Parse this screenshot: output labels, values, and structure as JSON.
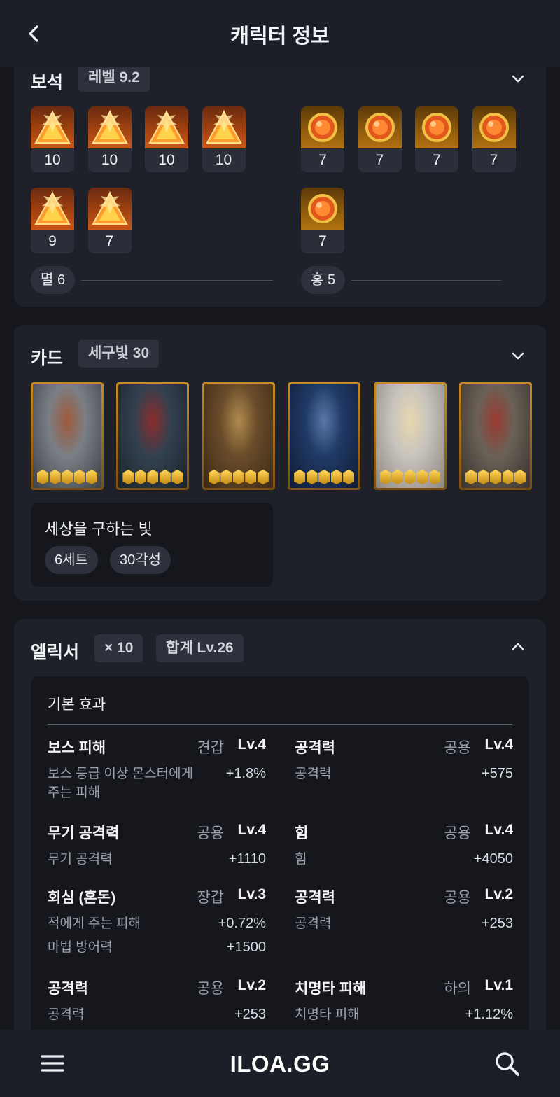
{
  "header": {
    "title": "캐릭터 정보",
    "back_icon": "chevron-left-icon"
  },
  "gems": {
    "title": "보석",
    "level_chip": "레벨 9.2",
    "left_items": [
      {
        "level": "10",
        "type": "red"
      },
      {
        "level": "10",
        "type": "red"
      },
      {
        "level": "10",
        "type": "red"
      },
      {
        "level": "10",
        "type": "red"
      },
      {
        "level": "9",
        "type": "red"
      },
      {
        "level": "7",
        "type": "red"
      }
    ],
    "right_items": [
      {
        "level": "7",
        "type": "orange"
      },
      {
        "level": "7",
        "type": "orange"
      },
      {
        "level": "7",
        "type": "orange"
      },
      {
        "level": "7",
        "type": "orange"
      },
      {
        "level": "7",
        "type": "orange"
      }
    ],
    "left_group": "멸 6",
    "right_group": "홍 5"
  },
  "cards": {
    "title": "카드",
    "set_chip": "세구빛 30",
    "count": 6,
    "awakening_per_card": 5,
    "set_name": "세상을 구하는 빛",
    "set_count": "6세트",
    "set_awakening": "30각성"
  },
  "elixir": {
    "title": "엘릭서",
    "count_chip": "× 10",
    "total_chip": "합계 Lv.26",
    "box_title": "기본 효과",
    "effects": [
      {
        "name": "보스 피해",
        "slot": "견갑",
        "level": "Lv.4",
        "lines": [
          {
            "label": "보스 등급 이상 몬스터에게 주는 피해",
            "value": "+1.8%"
          }
        ]
      },
      {
        "name": "공격력",
        "slot": "공용",
        "level": "Lv.4",
        "lines": [
          {
            "label": "공격력",
            "value": "+575"
          }
        ]
      },
      {
        "name": "무기 공격력",
        "slot": "공용",
        "level": "Lv.4",
        "lines": [
          {
            "label": "무기 공격력",
            "value": "+1110"
          }
        ]
      },
      {
        "name": "힘",
        "slot": "공용",
        "level": "Lv.4",
        "lines": [
          {
            "label": "힘",
            "value": "+4050"
          }
        ]
      },
      {
        "name": "회심 (혼돈)",
        "slot": "장갑",
        "level": "Lv.3",
        "lines": [
          {
            "label": "적에게 주는 피해",
            "value": "+0.72%"
          },
          {
            "label": "마법 방어력",
            "value": "+1500"
          }
        ]
      },
      {
        "name": "공격력",
        "slot": "공용",
        "level": "Lv.2",
        "lines": [
          {
            "label": "공격력",
            "value": "+253"
          }
        ]
      },
      {
        "name": "공격력",
        "slot": "공용",
        "level": "Lv.2",
        "lines": [
          {
            "label": "공격력",
            "value": "+253"
          }
        ]
      },
      {
        "name": "치명타 피해",
        "slot": "하의",
        "level": "Lv.1",
        "lines": [
          {
            "label": "치명타 피해",
            "value": "+1.12%"
          }
        ]
      }
    ]
  },
  "footer": {
    "brand": "ILOA.GG",
    "menu_icon": "hamburger-menu-icon",
    "search_icon": "search-icon"
  },
  "colors": {
    "background": "#15171d",
    "panel": "#1e2129",
    "chip": "#2d313b",
    "card_frame": "#c98b23"
  }
}
